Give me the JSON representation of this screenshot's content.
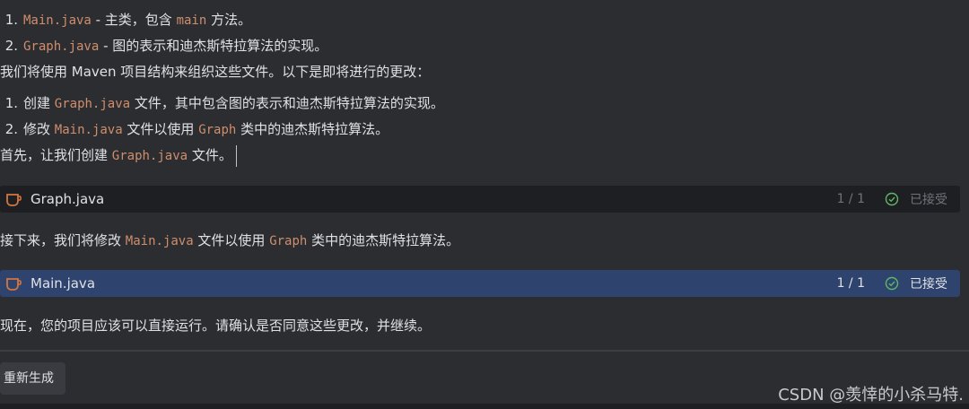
{
  "list1": [
    {
      "num": "1.",
      "code": "Main.java",
      "text": " - 主类，包含 ",
      "code2": "main",
      "text2": " 方法。"
    },
    {
      "num": "2.",
      "code": "Graph.java",
      "text": " - 图的表示和迪杰斯特拉算法的实现。"
    }
  ],
  "intro_text": "我们将使用 Maven 项目结构来组织这些文件。以下是即将进行的更改：",
  "list2": [
    {
      "num": "1.",
      "pre": "创建 ",
      "code": "Graph.java",
      "post": " 文件，其中包含图的表示和迪杰斯特拉算法的实现。"
    },
    {
      "num": "2.",
      "pre": "修改 ",
      "code": "Main.java",
      "mid": " 文件以使用 ",
      "code2": "Graph",
      "post": " 类中的迪杰斯特拉算法。"
    }
  ],
  "first_line": {
    "pre": "首先，让我们创建 ",
    "code": "Graph.java",
    "post": " 文件。"
  },
  "file1": {
    "name": "Graph.java",
    "count": "1 / 1",
    "status": "已接受"
  },
  "next_line": {
    "pre": "接下来，我们将修改 ",
    "code": "Main.java",
    "mid": " 文件以使用 ",
    "code2": "Graph",
    "post": " 类中的迪杰斯特拉算法。"
  },
  "file2": {
    "name": "Main.java",
    "count": "1 / 1",
    "status": "已接受"
  },
  "final_line": "现在，您的项目应该可以直接运行。请确认是否同意这些更改，并继续。",
  "regen_button": "重新生成",
  "watermark": "CSDN @羡悻的小杀马特.",
  "colors": {
    "code": "#cf8e6d",
    "accepted_check": "#5fb865",
    "blue_bar": "#2e436e"
  }
}
